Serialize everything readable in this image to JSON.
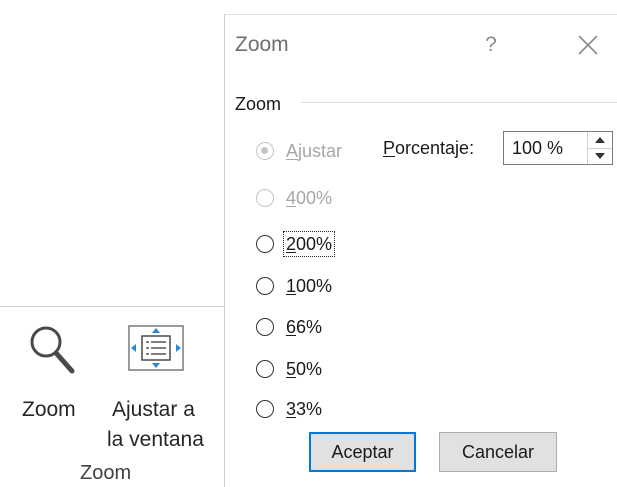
{
  "ribbon": {
    "zoom_label": "Zoom",
    "fit_label_line1": "Ajustar a",
    "fit_label_line2": "la ventana",
    "group_label": "Zoom",
    "icons": {
      "zoom": "magnifier-icon",
      "fit": "fit-to-window-icon"
    }
  },
  "dialog": {
    "title": "Zoom",
    "help_label": "?",
    "close_icon": "close-icon",
    "group_title": "Zoom",
    "options": [
      {
        "label": "Ajustar",
        "accesskey": "A",
        "checked": true,
        "disabled": true,
        "focused": false
      },
      {
        "label": "400%",
        "accesskey": "4",
        "checked": false,
        "disabled": true,
        "focused": false
      },
      {
        "label": "200%",
        "accesskey": "2",
        "checked": false,
        "disabled": false,
        "focused": true
      },
      {
        "label": "100%",
        "accesskey": "1",
        "checked": false,
        "disabled": false,
        "focused": false
      },
      {
        "label": "66%",
        "accesskey": "6",
        "checked": false,
        "disabled": false,
        "focused": false
      },
      {
        "label": "50%",
        "accesskey": "5",
        "checked": false,
        "disabled": false,
        "focused": false
      },
      {
        "label": "33%",
        "accesskey": "3",
        "checked": false,
        "disabled": false,
        "focused": false
      }
    ],
    "percent_label": "Porcentaje:",
    "percent_accesskey": "P",
    "percent_value": "100 %",
    "ok_label": "Aceptar",
    "cancel_label": "Cancelar",
    "colors": {
      "accent": "#0078d7",
      "disabled_text": "#a6a6a6"
    }
  }
}
